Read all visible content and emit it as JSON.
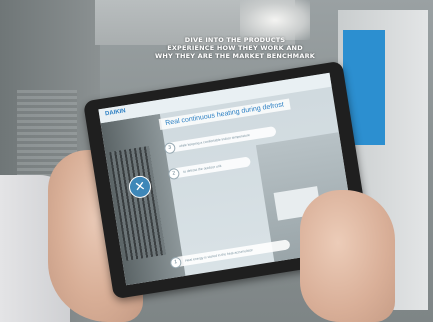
{
  "overlay": {
    "line1": "DIVE INTO THE PRODUCTS",
    "line2": "EXPERIENCE HOW THEY WORK AND",
    "line3": "WHY THEY ARE THE MARKET BENCHMARK"
  },
  "tablet_screen": {
    "logo": "DAIKIN",
    "title": "Real continuous heating during defrost",
    "steps": [
      {
        "number": "3",
        "text": "while keeping a comfortable indoor temperature"
      },
      {
        "number": "2",
        "text": "to defrost the outdoor unit"
      },
      {
        "number": "1",
        "text": "Heat energy is stored in the heat accumulator"
      }
    ],
    "close_icon": "close-icon"
  }
}
